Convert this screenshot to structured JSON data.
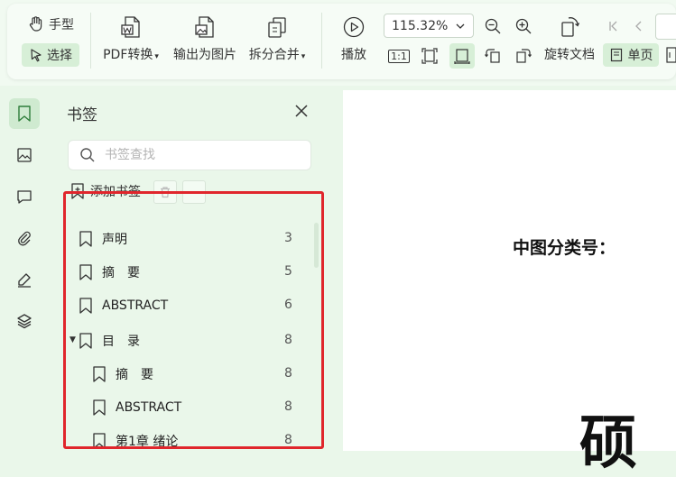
{
  "toolbar": {
    "hand_label": "手型",
    "select_label": "选择",
    "pdf_convert_label": "PDF转换",
    "export_image_label": "输出为图片",
    "split_merge_label": "拆分合并",
    "play_label": "播放",
    "zoom_value": "115.32%",
    "actual_size_label": "1:1",
    "rotate_doc_label": "旋转文档",
    "single_page_label": "单页"
  },
  "bookmark_panel": {
    "title": "书签",
    "search_placeholder": "书签查找",
    "add_bookmark_label": "添加书签",
    "items": [
      {
        "label": "声明",
        "page": "3",
        "level": 0
      },
      {
        "label": "摘　要",
        "page": "5",
        "level": 0
      },
      {
        "label": "ABSTRACT",
        "page": "6",
        "level": 0
      },
      {
        "label": "目　录",
        "page": "8",
        "level": 0,
        "expanded": true
      },
      {
        "label": "摘　要",
        "page": "8",
        "level": 1
      },
      {
        "label": "ABSTRACT",
        "page": "8",
        "level": 1
      },
      {
        "label": "第1章 绪论",
        "page": "8",
        "level": 1
      }
    ]
  },
  "document": {
    "classification_label": "中图分类号：",
    "big_char": "硕"
  },
  "colors": {
    "highlight_border": "#e0262c",
    "active_green": "#d7efd7",
    "background": "#eaf7ea"
  }
}
